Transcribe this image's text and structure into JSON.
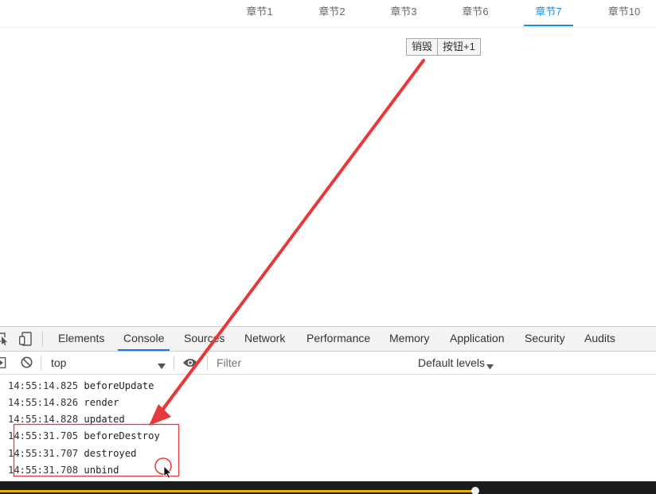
{
  "top_tabs": [
    {
      "label": "章节1",
      "active": false
    },
    {
      "label": "章节2",
      "active": false
    },
    {
      "label": "章节3",
      "active": false
    },
    {
      "label": "章节6",
      "active": false
    },
    {
      "label": "章节7",
      "active": true
    },
    {
      "label": "章节10",
      "active": false
    }
  ],
  "page_buttons": {
    "destroy": "销毁",
    "increment": "按钮+1"
  },
  "devtools": {
    "tabs": [
      {
        "label": "Elements",
        "active": false
      },
      {
        "label": "Console",
        "active": true
      },
      {
        "label": "Sources",
        "active": false
      },
      {
        "label": "Network",
        "active": false
      },
      {
        "label": "Performance",
        "active": false
      },
      {
        "label": "Memory",
        "active": false
      },
      {
        "label": "Application",
        "active": false
      },
      {
        "label": "Security",
        "active": false
      },
      {
        "label": "Audits",
        "active": false
      }
    ],
    "toolbar": {
      "context": "top",
      "filter_placeholder": "Filter",
      "levels": "Default levels"
    },
    "console_lines": [
      {
        "time": "14:55:14.825",
        "msg": "beforeUpdate"
      },
      {
        "time": "14:55:14.826",
        "msg": "render"
      },
      {
        "time": "14:55:14.828",
        "msg": "updated"
      },
      {
        "time": "14:55:31.705",
        "msg": "beforeDestroy"
      },
      {
        "time": "14:55:31.707",
        "msg": "destroyed"
      },
      {
        "time": "14:55:31.708",
        "msg": "unbind"
      }
    ]
  },
  "player": {
    "progress_fraction": 0.725
  },
  "colors": {
    "active_tab": "#1a8fe0",
    "annotation": "#e8383a",
    "progress": "#e0b400"
  },
  "icons": [
    "inspect-icon",
    "device-toggle-icon",
    "sidebar-toggle-icon",
    "clear-console-icon",
    "eye-icon",
    "dropdown-arrow-icon",
    "mouse-cursor-icon"
  ]
}
